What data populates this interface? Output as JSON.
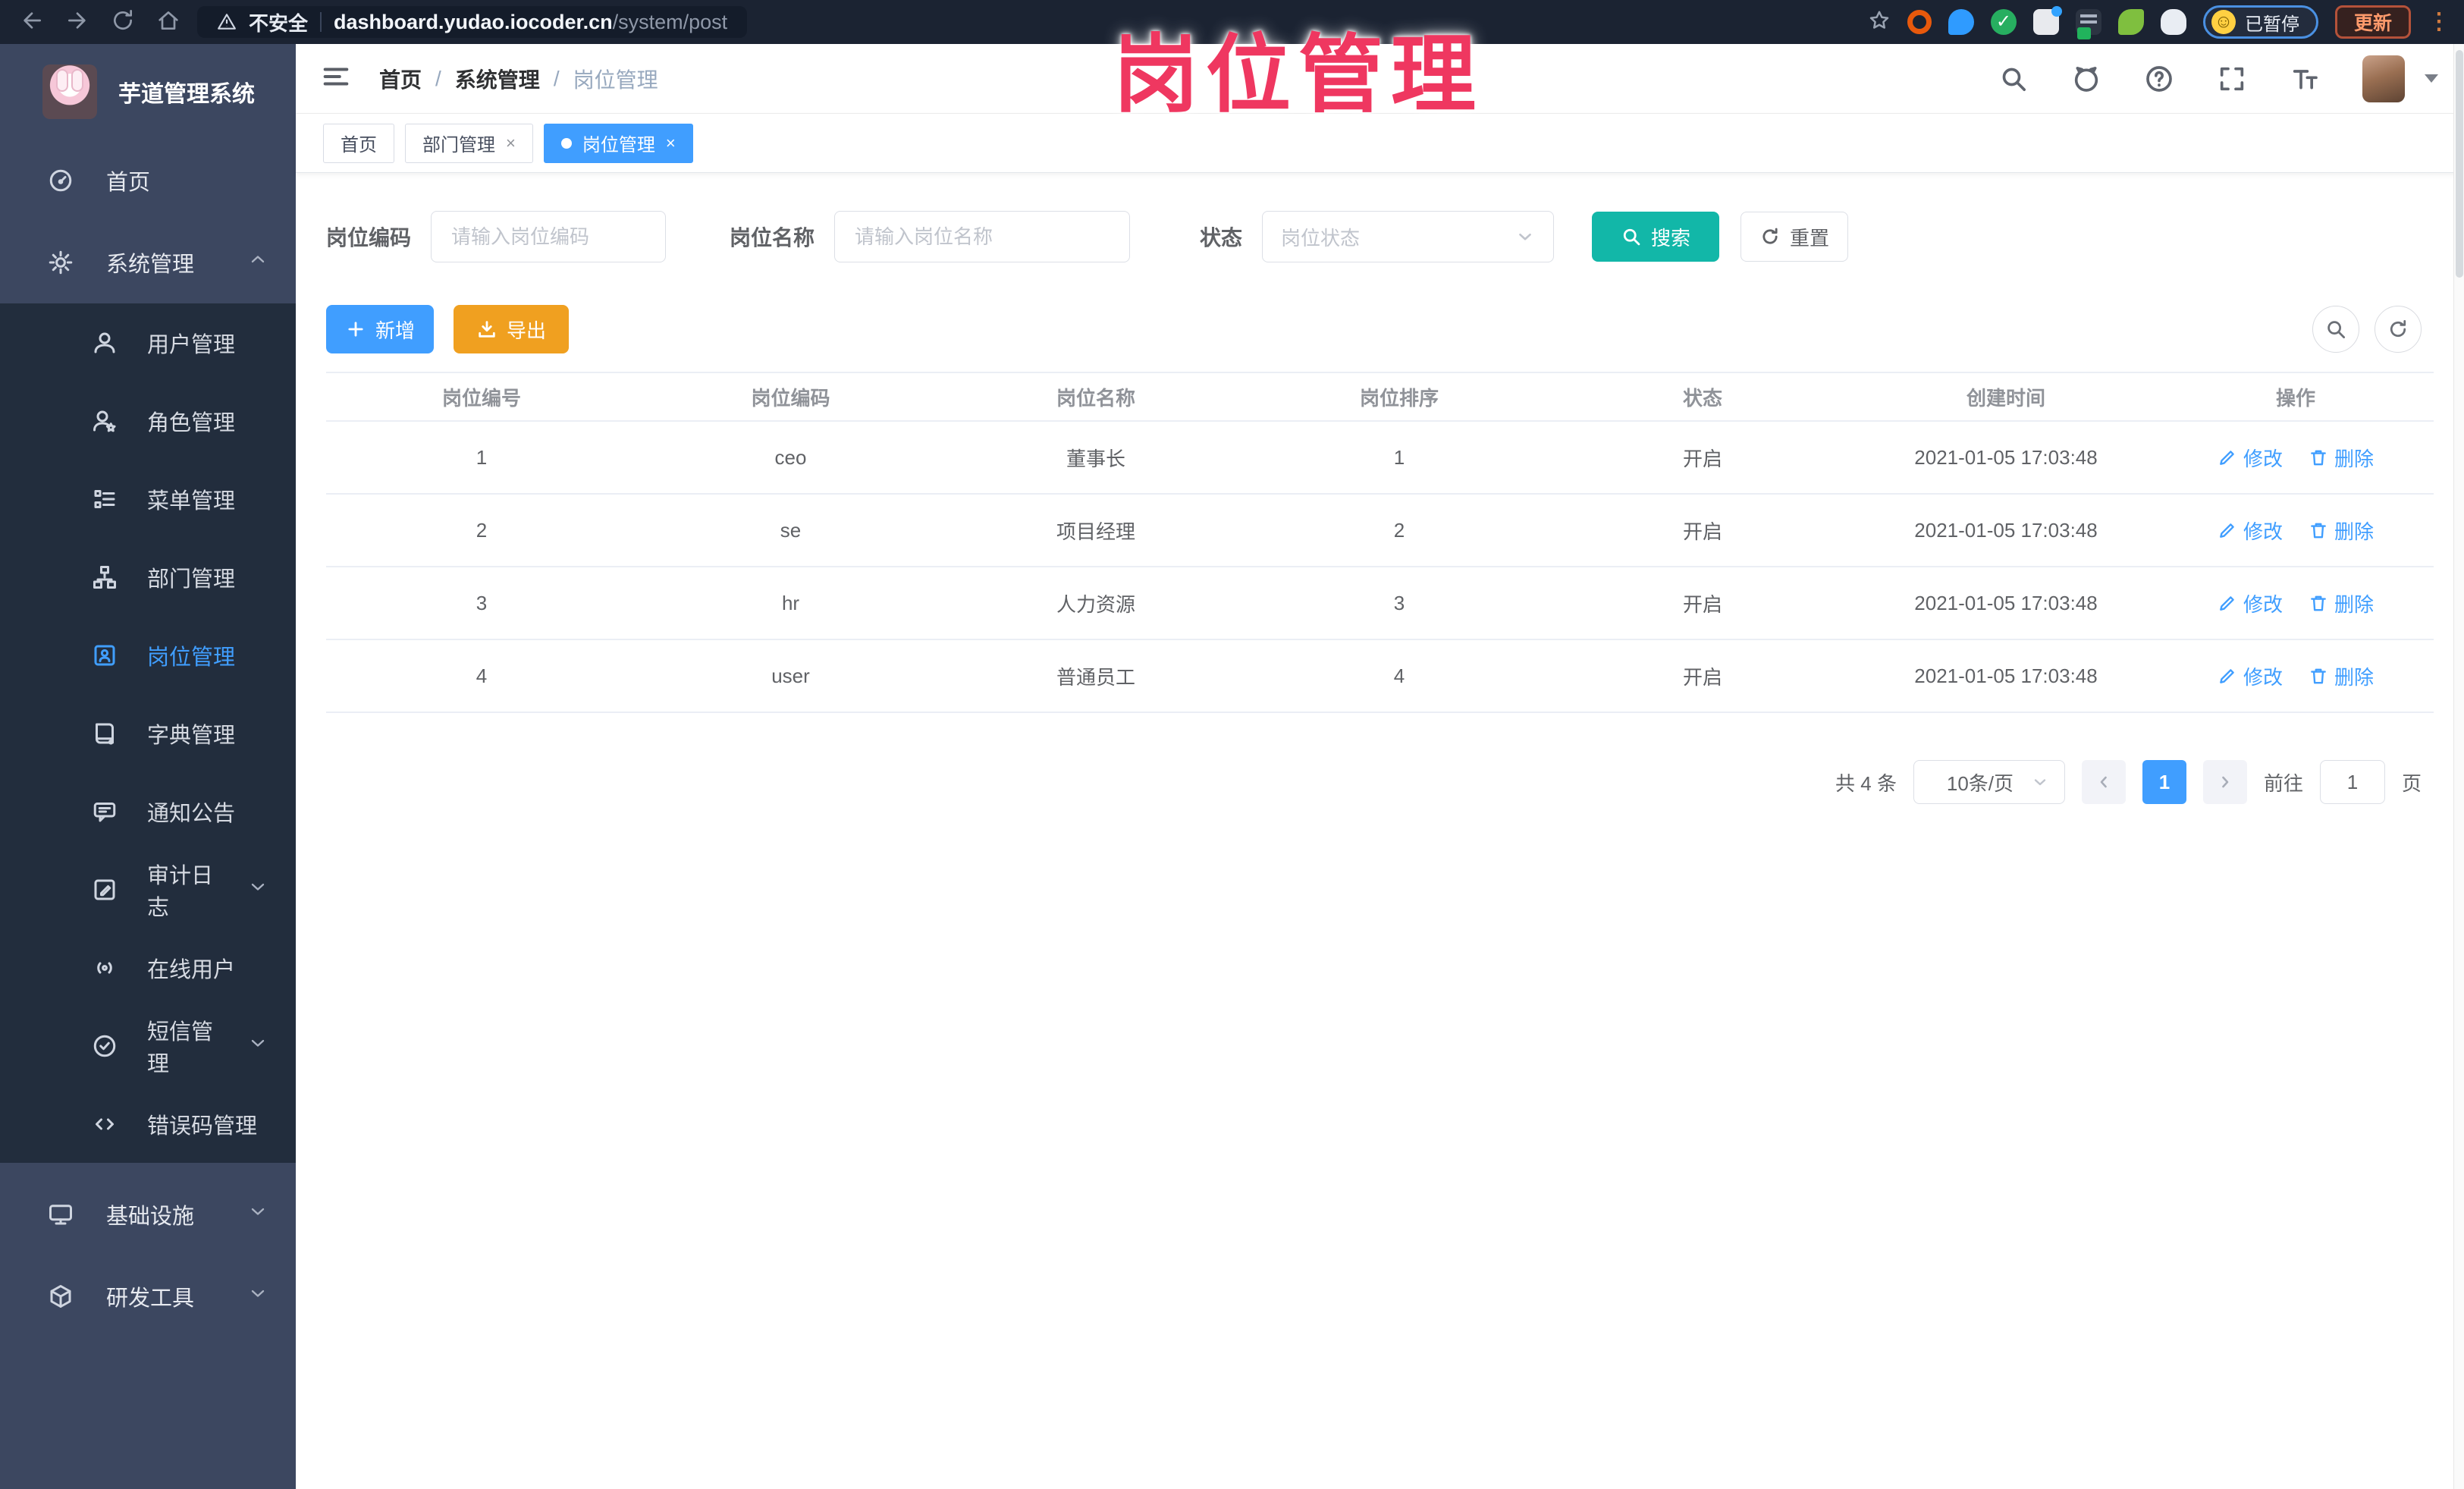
{
  "overlay_title": "岗位管理",
  "browser": {
    "security": "不安全",
    "url_host": "dashboard.yudao.iocoder.cn",
    "url_path": "/system/post",
    "paused": "已暂停",
    "update": "更新"
  },
  "sidebar": {
    "title": "芋道管理系统",
    "home": "首页",
    "system": "系统管理",
    "submenu": [
      "用户管理",
      "角色管理",
      "菜单管理",
      "部门管理",
      "岗位管理",
      "字典管理",
      "通知公告",
      "审计日志",
      "在线用户",
      "短信管理",
      "错误码管理"
    ],
    "bottom": [
      "基础设施",
      "研发工具"
    ]
  },
  "header": {
    "breadcrumb": [
      "首页",
      "系统管理",
      "岗位管理"
    ]
  },
  "tags": [
    "首页",
    "部门管理",
    "岗位管理"
  ],
  "filters": {
    "code_label": "岗位编码",
    "code_placeholder": "请输入岗位编码",
    "name_label": "岗位名称",
    "name_placeholder": "请输入岗位名称",
    "status_label": "状态",
    "status_placeholder": "岗位状态",
    "search": "搜索",
    "reset": "重置"
  },
  "toolbar": {
    "add": "新增",
    "export": "导出"
  },
  "table": {
    "headers": [
      "岗位编号",
      "岗位编码",
      "岗位名称",
      "岗位排序",
      "状态",
      "创建时间",
      "操作"
    ],
    "edit": "修改",
    "delete": "删除",
    "rows": [
      {
        "id": "1",
        "code": "ceo",
        "name": "董事长",
        "sort": "1",
        "status": "开启",
        "time": "2021-01-05 17:03:48"
      },
      {
        "id": "2",
        "code": "se",
        "name": "项目经理",
        "sort": "2",
        "status": "开启",
        "time": "2021-01-05 17:03:48"
      },
      {
        "id": "3",
        "code": "hr",
        "name": "人力资源",
        "sort": "3",
        "status": "开启",
        "time": "2021-01-05 17:03:48"
      },
      {
        "id": "4",
        "code": "user",
        "name": "普通员工",
        "sort": "4",
        "status": "开启",
        "time": "2021-01-05 17:03:48"
      }
    ]
  },
  "pagination": {
    "total": "共 4 条",
    "page_size": "10条/页",
    "current": "1",
    "goto": "前往",
    "page_unit": "页",
    "goto_value": "1"
  },
  "colors": {
    "accent": "#409EFF",
    "teal": "#12b7a8",
    "orange": "#f0a020",
    "pink": "#ef3760"
  }
}
